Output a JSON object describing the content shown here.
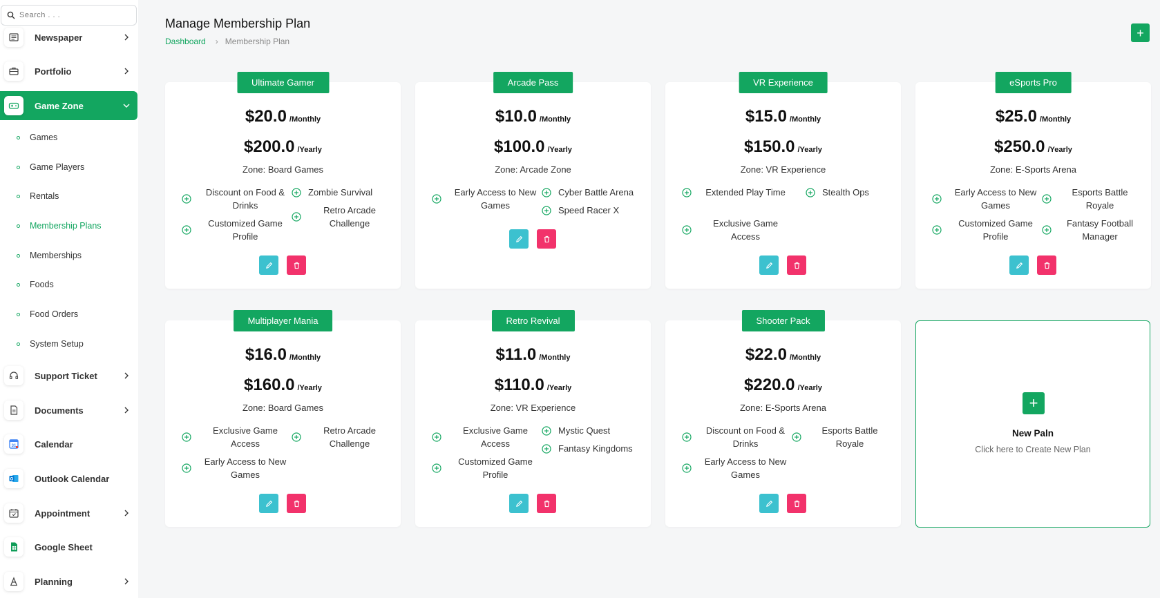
{
  "search": {
    "placeholder": "Search . . ."
  },
  "sidebar": {
    "items": [
      {
        "label": "Newspaper"
      },
      {
        "label": "Portfolio"
      },
      {
        "label": "Game Zone"
      },
      {
        "label": "Support Ticket"
      },
      {
        "label": "Documents"
      },
      {
        "label": "Calendar"
      },
      {
        "label": "Outlook Calendar"
      },
      {
        "label": "Appointment"
      },
      {
        "label": "Google Sheet"
      },
      {
        "label": "Planning"
      }
    ],
    "sub_items": [
      {
        "label": "Games"
      },
      {
        "label": "Game Players"
      },
      {
        "label": "Rentals"
      },
      {
        "label": "Membership Plans"
      },
      {
        "label": "Memberships"
      },
      {
        "label": "Foods"
      },
      {
        "label": "Food Orders"
      },
      {
        "label": "System Setup"
      }
    ]
  },
  "header": {
    "title": "Manage Membership Plan",
    "breadcrumb": {
      "home": "Dashboard",
      "separator": "›",
      "current": "Membership Plan"
    },
    "add_button": "+"
  },
  "plans": [
    {
      "name": "Ultimate Gamer",
      "monthly": "$20.0",
      "monthly_unit": "/Monthly",
      "yearly": "$200.0",
      "yearly_unit": "/Yearly",
      "zone": "Zone: Board Games",
      "features": [
        "Discount on Food & Drinks",
        "Zombie Survival",
        "Customized Game Profile",
        "Retro Arcade Challenge"
      ]
    },
    {
      "name": "Arcade Pass",
      "monthly": "$10.0",
      "monthly_unit": "/Monthly",
      "yearly": "$100.0",
      "yearly_unit": "/Yearly",
      "zone": "Zone: Arcade Zone",
      "features": [
        "Early Access to New Games",
        "Cyber Battle Arena",
        "Speed Racer X"
      ]
    },
    {
      "name": "VR Experience",
      "monthly": "$15.0",
      "monthly_unit": "/Monthly",
      "yearly": "$150.0",
      "yearly_unit": "/Yearly",
      "zone": "Zone: VR Experience",
      "features": [
        "Extended Play Time",
        "Stealth Ops",
        "Exclusive Game Access"
      ]
    },
    {
      "name": "eSports Pro",
      "monthly": "$25.0",
      "monthly_unit": "/Monthly",
      "yearly": "$250.0",
      "yearly_unit": "/Yearly",
      "zone": "Zone: E-Sports Arena",
      "features": [
        "Early Access to New Games",
        "Esports Battle Royale",
        "Customized Game Profile",
        "Fantasy Football Manager"
      ]
    },
    {
      "name": "Multiplayer Mania",
      "monthly": "$16.0",
      "monthly_unit": "/Monthly",
      "yearly": "$160.0",
      "yearly_unit": "/Yearly",
      "zone": "Zone: Board Games",
      "features": [
        "Exclusive Game Access",
        "Retro Arcade Challenge",
        "Early Access to New Games"
      ]
    },
    {
      "name": "Retro Revival",
      "monthly": "$11.0",
      "monthly_unit": "/Monthly",
      "yearly": "$110.0",
      "yearly_unit": "/Yearly",
      "zone": "Zone: VR Experience",
      "features": [
        "Exclusive Game Access",
        "Mystic Quest",
        "Fantasy Kingdoms",
        "Customized Game Profile"
      ]
    },
    {
      "name": "Shooter Pack",
      "monthly": "$22.0",
      "monthly_unit": "/Monthly",
      "yearly": "$220.0",
      "yearly_unit": "/Yearly",
      "zone": "Zone: E-Sports Arena",
      "features": [
        "Discount on Food & Drinks",
        "Esports Battle Royale",
        "Early Access to New Games"
      ]
    }
  ],
  "new_plan": {
    "plus": "+",
    "title": "New Paln",
    "subtitle": "Click here to Create New Plan"
  },
  "colors": {
    "accent": "#13a660",
    "edit": "#3cc1cf",
    "delete": "#f2326b"
  }
}
